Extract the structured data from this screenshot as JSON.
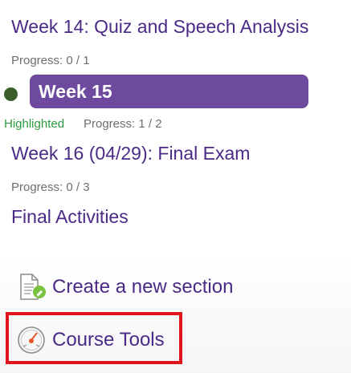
{
  "sections": [
    {
      "title": "Week 14: Quiz and Speech Analysis",
      "progress": "Progress: 0 / 1"
    },
    {
      "title": "Week 15",
      "progress": "Progress: 1 / 2",
      "highlighted_label": "Highlighted"
    },
    {
      "title": "Week 16 (04/29): Final Exam",
      "progress": "Progress: 0 / 3"
    },
    {
      "title": "Final Activities"
    }
  ],
  "actions": {
    "create_section": {
      "label": "Create a new section",
      "icon": "document-add-icon"
    },
    "course_tools": {
      "label": "Course Tools",
      "icon": "speedometer-icon"
    }
  },
  "colors": {
    "title": "#4a2a86",
    "current_pill": "#6d4a9e",
    "highlight_dot": "#3b5e2b",
    "highlighted_text": "#2e9a3e",
    "annotation_box": "#e0141b"
  }
}
